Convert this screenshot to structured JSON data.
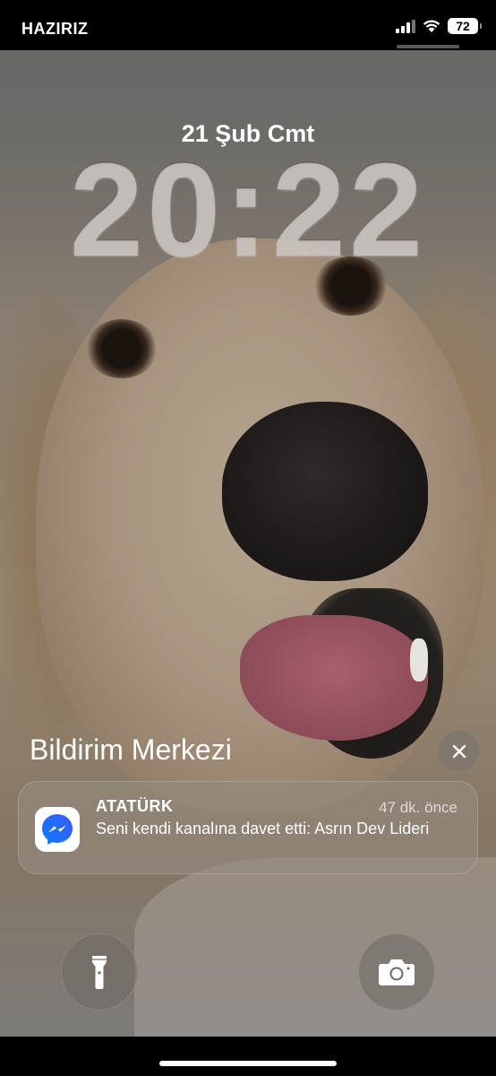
{
  "status_bar": {
    "carrier": "HAZIRIZ",
    "battery": "72",
    "icons": [
      "cellular-signal-icon",
      "wifi-icon",
      "battery-icon"
    ]
  },
  "lock_screen": {
    "date": "21 Şub Cmt",
    "time": "20:22",
    "wallpaper": "golden retriever close-up photo"
  },
  "notification_center": {
    "title": "Bildirim Merkezi",
    "close_icon": "close-icon",
    "notifications": [
      {
        "app_icon": "messenger-icon",
        "sender": "ATATÜRK",
        "time": "47 dk. önce",
        "body": "Seni kendi kanalına davet etti: Asrın Dev Lideri"
      }
    ]
  },
  "quick_actions": {
    "left_icon": "flashlight-icon",
    "right_icon": "camera-icon"
  },
  "colors": {
    "messenger_gradient_start": "#0a7cff",
    "messenger_gradient_end": "#3d5bff",
    "notification_bg": "#968c82"
  }
}
